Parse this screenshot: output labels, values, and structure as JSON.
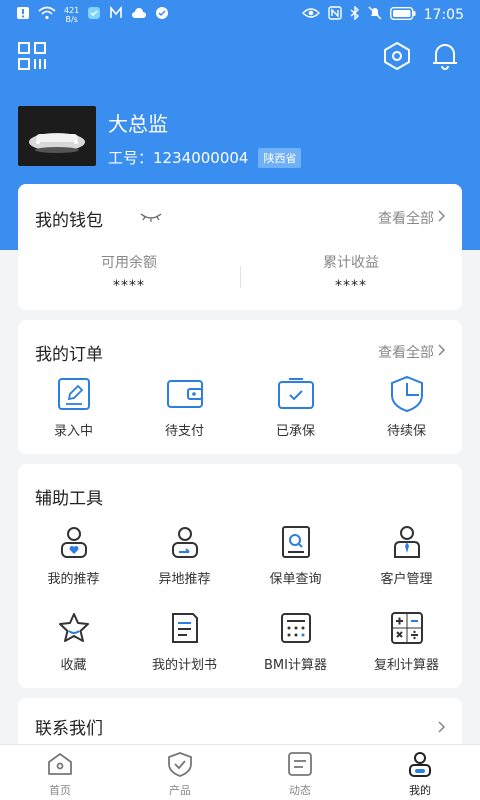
{
  "status_bar": {
    "net_speed_value": "421",
    "net_speed_unit": "B/s",
    "time": "17:05"
  },
  "profile": {
    "name": "大总监",
    "id_label": "工号：",
    "id_value": "1234000004",
    "region": "陕西省"
  },
  "wallet": {
    "title": "我的钱包",
    "more": "查看全部",
    "available_label": "可用余额",
    "available_value": "****",
    "earnings_label": "累计收益",
    "earnings_value": "****"
  },
  "orders": {
    "title": "我的订单",
    "more": "查看全部",
    "items": [
      {
        "label": "录入中",
        "icon": "edit-icon"
      },
      {
        "label": "待支付",
        "icon": "wallet-icon"
      },
      {
        "label": "已承保",
        "icon": "check-box-icon"
      },
      {
        "label": "待续保",
        "icon": "shield-pie-icon"
      }
    ]
  },
  "tools": {
    "title": "辅助工具",
    "items": [
      {
        "label": "我的推荐",
        "icon": "user-heart-icon"
      },
      {
        "label": "异地推荐",
        "icon": "user-arrow-icon"
      },
      {
        "label": "保单查询",
        "icon": "policy-search-icon"
      },
      {
        "label": "客户管理",
        "icon": "user-tie-icon"
      },
      {
        "label": "收藏",
        "icon": "star-icon"
      },
      {
        "label": "我的计划书",
        "icon": "plan-book-icon"
      },
      {
        "label": "BMI计算器",
        "icon": "calculator-icon"
      },
      {
        "label": "复利计算器",
        "icon": "math-calculator-icon"
      }
    ]
  },
  "contact": {
    "title": "联系我们"
  },
  "tabbar": {
    "tabs": [
      {
        "label": "首页",
        "icon": "home-icon"
      },
      {
        "label": "产品",
        "icon": "shield-check-icon"
      },
      {
        "label": "动态",
        "icon": "list-icon"
      },
      {
        "label": "我的",
        "icon": "profile-icon"
      }
    ],
    "active": "我的"
  },
  "colors": {
    "brand": "#3a8ef0",
    "icon": "#2b7fe0"
  }
}
